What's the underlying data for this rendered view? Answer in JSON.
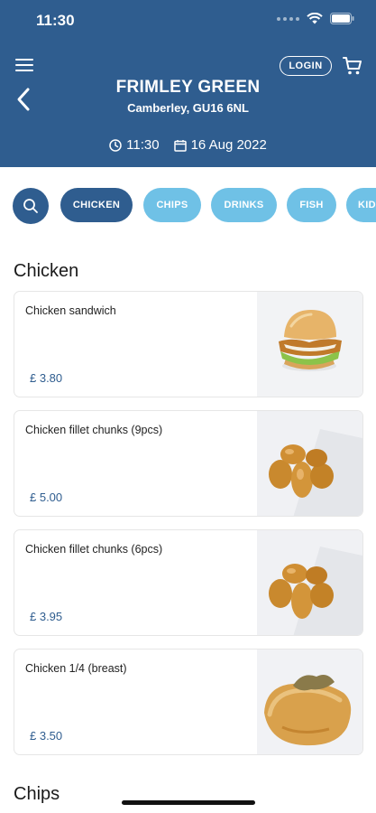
{
  "status": {
    "time": "11:30"
  },
  "header": {
    "store_name": "FRIMLEY GREEN",
    "store_location": "Camberley, GU16 6NL",
    "login_label": "LOGIN",
    "order_time": "11:30",
    "order_date": "16 Aug 2022",
    "bg_color": "#2f5d8f"
  },
  "categories": [
    {
      "label": "CHICKEN",
      "active": true
    },
    {
      "label": "CHIPS",
      "active": false
    },
    {
      "label": "DRINKS",
      "active": false
    },
    {
      "label": "FISH",
      "active": false
    },
    {
      "label": "KID",
      "active": false
    }
  ],
  "sections": [
    {
      "title": "Chicken",
      "items": [
        {
          "name": "Chicken sandwich",
          "price": "£ 3.80",
          "image": "chicken-sandwich"
        },
        {
          "name": "Chicken fillet chunks (9pcs)",
          "price": "£ 5.00",
          "image": "chicken-chunks"
        },
        {
          "name": "Chicken fillet chunks (6pcs)",
          "price": "£ 3.95",
          "image": "chicken-chunks"
        },
        {
          "name": "Chicken 1/4 (breast)",
          "price": "£ 3.50",
          "image": "chicken-quarter"
        }
      ]
    },
    {
      "title": "Chips",
      "items": []
    }
  ],
  "colors": {
    "primary": "#2f5d8f",
    "pill_inactive": "#6fc1e6",
    "price": "#2f5d8f"
  }
}
